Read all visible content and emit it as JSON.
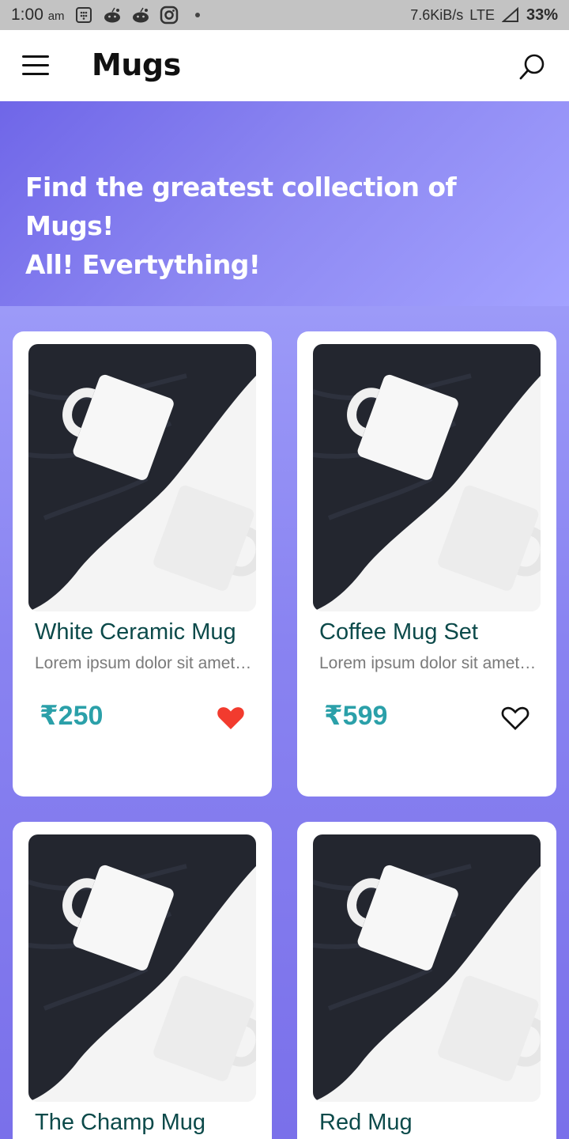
{
  "status_bar": {
    "time": "1:00",
    "ampm": "am",
    "network_speed": "7.6KiB/s",
    "network_type": "LTE",
    "battery": "33%",
    "icons": [
      "calculator-icon",
      "reddit-icon",
      "reddit-icon",
      "instagram-icon",
      "notification-dot-icon",
      "signal-icon"
    ]
  },
  "app_bar": {
    "title": "Mugs",
    "menu_icon": "hamburger-menu-icon",
    "search_icon": "search-icon"
  },
  "hero": {
    "line1": "Find the greatest collection of Mugs!",
    "line2": "All! Evertything!"
  },
  "colors": {
    "price": "#2ba0a9",
    "product_name": "#0c4a4a",
    "heart_active": "#f23b2e",
    "hero_start": "#6f66e8",
    "hero_end": "#a3a2ff"
  },
  "products": [
    {
      "name": "White Ceramic Mug",
      "description": "Lorem ipsum dolor sit amet, consectetur",
      "price": "₹250",
      "favorite": true,
      "image": "mugs-on-dark-cloth"
    },
    {
      "name": "Coffee Mug Set",
      "description": "Lorem ipsum dolor sit amet, consectetur",
      "price": "₹599",
      "favorite": false,
      "image": "mugs-on-dark-cloth"
    },
    {
      "name": "The Champ Mug",
      "description": "",
      "price": "",
      "favorite": false,
      "image": "mugs-on-dark-cloth"
    },
    {
      "name": "Red Mug",
      "description": "",
      "price": "",
      "favorite": false,
      "image": "mugs-on-dark-cloth"
    }
  ]
}
